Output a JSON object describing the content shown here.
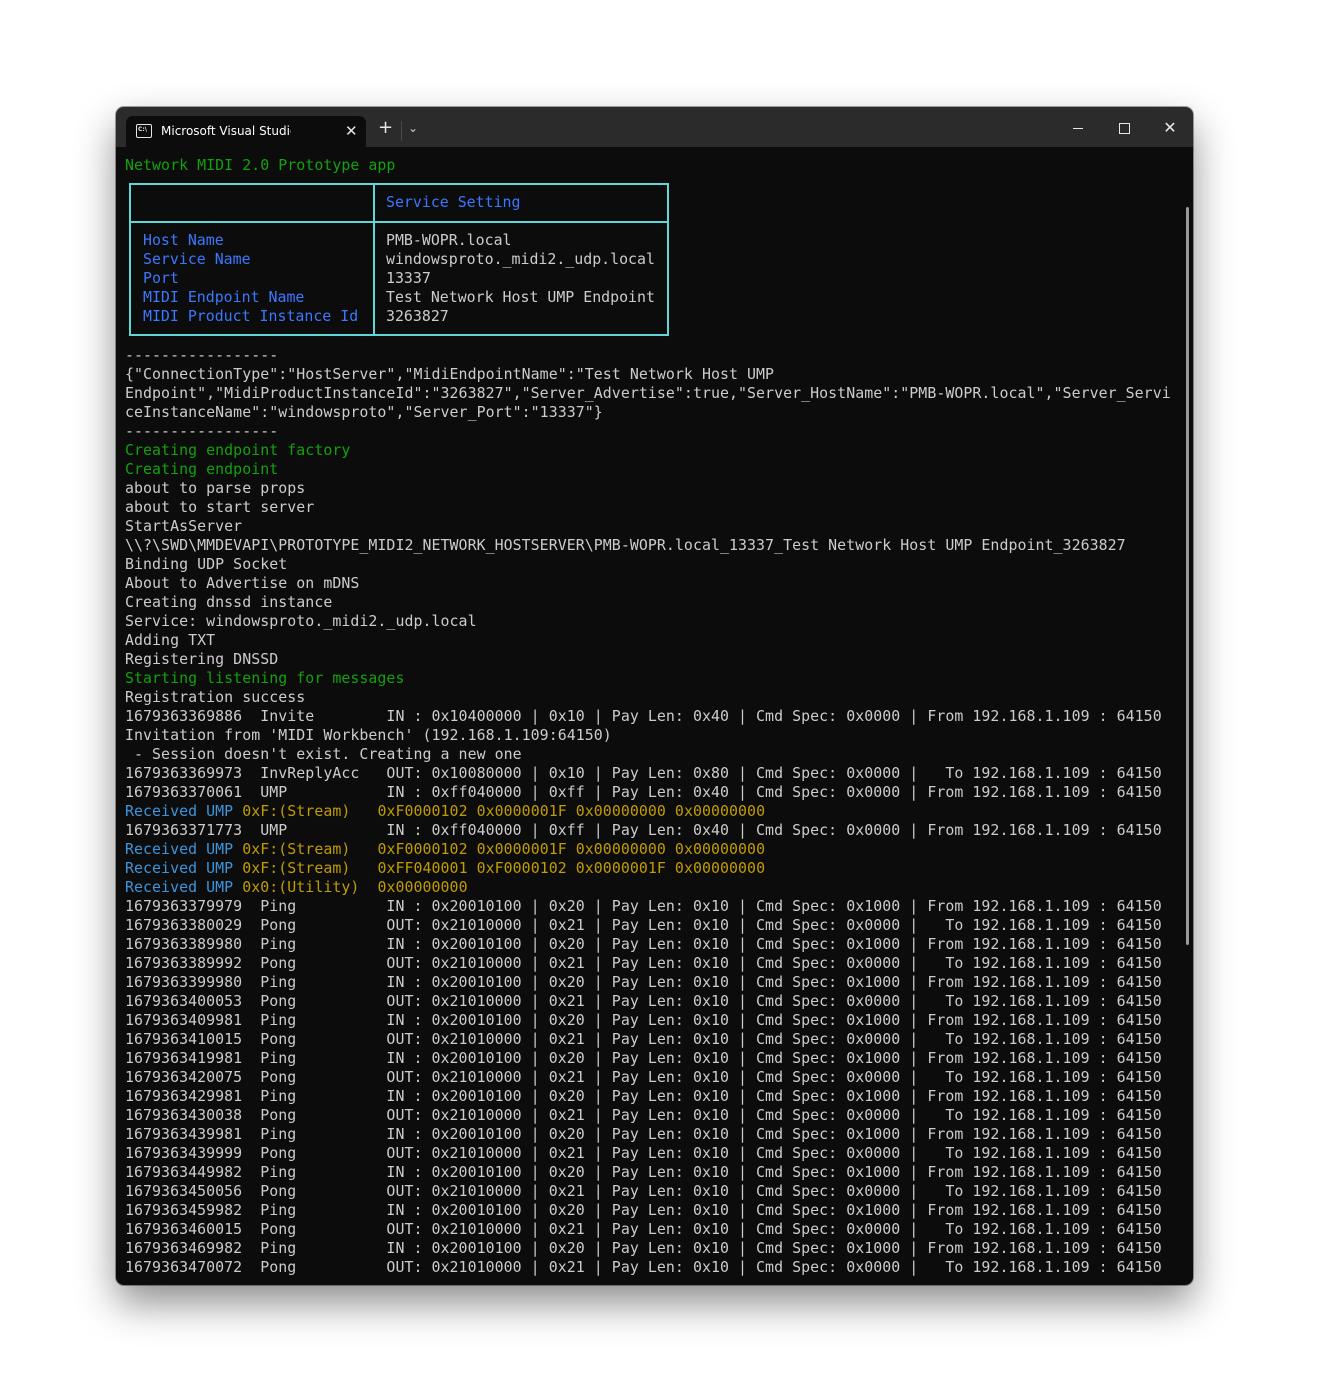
{
  "window": {
    "tab_title": "Microsoft Visual Studio Debug Console",
    "tab_icon": "console-icon",
    "new_tab": "+",
    "dropdown": "⌄",
    "close_tab": "✕",
    "minimize": "minimize-icon",
    "maximize": "maximize-icon",
    "close": "✕"
  },
  "colors": {
    "background": "#0c0c0c",
    "text": "#cccccc",
    "green": "#13a10e",
    "blue": "#3b78ff",
    "light_blue": "#3a96dd",
    "yellow": "#c19c00",
    "table_border": "#61d6d6"
  },
  "header": "Network MIDI 2.0 Prototype app",
  "settings_table": {
    "column_header": "Service Setting",
    "rows": [
      {
        "label": "Host Name",
        "value": "PMB-WOPR.local"
      },
      {
        "label": "Service Name",
        "value": "windowsproto._midi2._udp.local"
      },
      {
        "label": "Port",
        "value": "13337"
      },
      {
        "label": "MIDI Endpoint Name",
        "value": "Test Network Host UMP Endpoint"
      },
      {
        "label": "MIDI Product Instance Id",
        "value": "3263827"
      }
    ]
  },
  "separator": "-----------------",
  "json_lines": [
    "{\"ConnectionType\":\"HostServer\",\"MidiEndpointName\":\"Test Network Host UMP",
    "Endpoint\",\"MidiProductInstanceId\":\"3263827\",\"Server_Advertise\":true,\"Server_HostName\":\"PMB-WOPR.local\",\"Server_Servi",
    "ceInstanceName\":\"windowsproto\",\"Server_Port\":\"13337\"}"
  ],
  "log_lines": [
    {
      "text": "Creating endpoint factory",
      "style": "green"
    },
    {
      "text": "Creating endpoint",
      "style": "green"
    },
    {
      "text": "about to parse props",
      "style": "normal"
    },
    {
      "text": "about to start server",
      "style": "normal"
    },
    {
      "text": "StartAsServer",
      "style": "normal"
    },
    {
      "text": "\\\\?\\SWD\\MMDEVAPI\\PROTOTYPE_MIDI2_NETWORK_HOSTSERVER\\PMB-WOPR.local_13337_Test Network Host UMP Endpoint_3263827",
      "style": "normal"
    },
    {
      "text": "Binding UDP Socket",
      "style": "normal"
    },
    {
      "text": "About to Advertise on mDNS",
      "style": "normal"
    },
    {
      "text": "Creating dnssd instance",
      "style": "normal"
    },
    {
      "text": "Service: windowsproto._midi2._udp.local",
      "style": "normal"
    },
    {
      "text": "Adding TXT",
      "style": "normal"
    },
    {
      "text": "Registering DNSSD",
      "style": "normal"
    },
    {
      "text": "Starting listening for messages",
      "style": "green"
    },
    {
      "text": "Registration success",
      "style": "normal"
    }
  ],
  "message_lines": [
    {
      "type": "packet",
      "text": "1679363369886  Invite        IN : 0x10400000 | 0x10 | Pay Len: 0x40 | Cmd Spec: 0x0000 | From 192.168.1.109 : 64150"
    },
    {
      "type": "plain",
      "text": "Invitation from 'MIDI Workbench' (192.168.1.109:64150)"
    },
    {
      "type": "plain",
      "text": " - Session doesn't exist. Creating a new one"
    },
    {
      "type": "packet",
      "text": "1679363369973  InvReplyAcc   OUT: 0x10080000 | 0x10 | Pay Len: 0x80 | Cmd Spec: 0x0000 |   To 192.168.1.109 : 64150"
    },
    {
      "type": "packet",
      "text": "1679363370061  UMP           IN : 0xff040000 | 0xff | Pay Len: 0x40 | Cmd Spec: 0x0000 | From 192.168.1.109 : 64150"
    },
    {
      "type": "ump",
      "prefix": "Received UMP",
      "kind": "0xF:(Stream)",
      "words": "     0xF0000102 0x0000001F 0x00000000 0x00000000"
    },
    {
      "type": "packet",
      "text": "1679363371773  UMP           IN : 0xff040000 | 0xff | Pay Len: 0x40 | Cmd Spec: 0x0000 | From 192.168.1.109 : 64150"
    },
    {
      "type": "ump",
      "prefix": "Received UMP",
      "kind": "0xF:(Stream)",
      "words": "     0xF0000102 0x0000001F 0x00000000 0x00000000"
    },
    {
      "type": "ump",
      "prefix": "Received UMP",
      "kind": "0xF:(Stream)",
      "words": "     0xFF040001 0xF0000102 0x0000001F 0x00000000"
    },
    {
      "type": "ump",
      "prefix": "Received UMP",
      "kind": "0x0:(Utility)",
      "words": "    0x00000000"
    },
    {
      "type": "packet",
      "text": "1679363379979  Ping          IN : 0x20010100 | 0x20 | Pay Len: 0x10 | Cmd Spec: 0x1000 | From 192.168.1.109 : 64150"
    },
    {
      "type": "packet",
      "text": "1679363380029  Pong          OUT: 0x21010000 | 0x21 | Pay Len: 0x10 | Cmd Spec: 0x0000 |   To 192.168.1.109 : 64150"
    },
    {
      "type": "packet",
      "text": "1679363389980  Ping          IN : 0x20010100 | 0x20 | Pay Len: 0x10 | Cmd Spec: 0x1000 | From 192.168.1.109 : 64150"
    },
    {
      "type": "packet",
      "text": "1679363389992  Pong          OUT: 0x21010000 | 0x21 | Pay Len: 0x10 | Cmd Spec: 0x0000 |   To 192.168.1.109 : 64150"
    },
    {
      "type": "packet",
      "text": "1679363399980  Ping          IN : 0x20010100 | 0x20 | Pay Len: 0x10 | Cmd Spec: 0x1000 | From 192.168.1.109 : 64150"
    },
    {
      "type": "packet",
      "text": "1679363400053  Pong          OUT: 0x21010000 | 0x21 | Pay Len: 0x10 | Cmd Spec: 0x0000 |   To 192.168.1.109 : 64150"
    },
    {
      "type": "packet",
      "text": "1679363409981  Ping          IN : 0x20010100 | 0x20 | Pay Len: 0x10 | Cmd Spec: 0x1000 | From 192.168.1.109 : 64150"
    },
    {
      "type": "packet",
      "text": "1679363410015  Pong          OUT: 0x21010000 | 0x21 | Pay Len: 0x10 | Cmd Spec: 0x0000 |   To 192.168.1.109 : 64150"
    },
    {
      "type": "packet",
      "text": "1679363419981  Ping          IN : 0x20010100 | 0x20 | Pay Len: 0x10 | Cmd Spec: 0x1000 | From 192.168.1.109 : 64150"
    },
    {
      "type": "packet",
      "text": "1679363420075  Pong          OUT: 0x21010000 | 0x21 | Pay Len: 0x10 | Cmd Spec: 0x0000 |   To 192.168.1.109 : 64150"
    },
    {
      "type": "packet",
      "text": "1679363429981  Ping          IN : 0x20010100 | 0x20 | Pay Len: 0x10 | Cmd Spec: 0x1000 | From 192.168.1.109 : 64150"
    },
    {
      "type": "packet",
      "text": "1679363430038  Pong          OUT: 0x21010000 | 0x21 | Pay Len: 0x10 | Cmd Spec: 0x0000 |   To 192.168.1.109 : 64150"
    },
    {
      "type": "packet",
      "text": "1679363439981  Ping          IN : 0x20010100 | 0x20 | Pay Len: 0x10 | Cmd Spec: 0x1000 | From 192.168.1.109 : 64150"
    },
    {
      "type": "packet",
      "text": "1679363439999  Pong          OUT: 0x21010000 | 0x21 | Pay Len: 0x10 | Cmd Spec: 0x0000 |   To 192.168.1.109 : 64150"
    },
    {
      "type": "packet",
      "text": "1679363449982  Ping          IN : 0x20010100 | 0x20 | Pay Len: 0x10 | Cmd Spec: 0x1000 | From 192.168.1.109 : 64150"
    },
    {
      "type": "packet",
      "text": "1679363450056  Pong          OUT: 0x21010000 | 0x21 | Pay Len: 0x10 | Cmd Spec: 0x0000 |   To 192.168.1.109 : 64150"
    },
    {
      "type": "packet",
      "text": "1679363459982  Ping          IN : 0x20010100 | 0x20 | Pay Len: 0x10 | Cmd Spec: 0x1000 | From 192.168.1.109 : 64150"
    },
    {
      "type": "packet",
      "text": "1679363460015  Pong          OUT: 0x21010000 | 0x21 | Pay Len: 0x10 | Cmd Spec: 0x0000 |   To 192.168.1.109 : 64150"
    },
    {
      "type": "packet",
      "text": "1679363469982  Ping          IN : 0x20010100 | 0x20 | Pay Len: 0x10 | Cmd Spec: 0x1000 | From 192.168.1.109 : 64150"
    },
    {
      "type": "packet",
      "text": "1679363470072  Pong          OUT: 0x21010000 | 0x21 | Pay Len: 0x10 | Cmd Spec: 0x0000 |   To 192.168.1.109 : 64150"
    }
  ]
}
